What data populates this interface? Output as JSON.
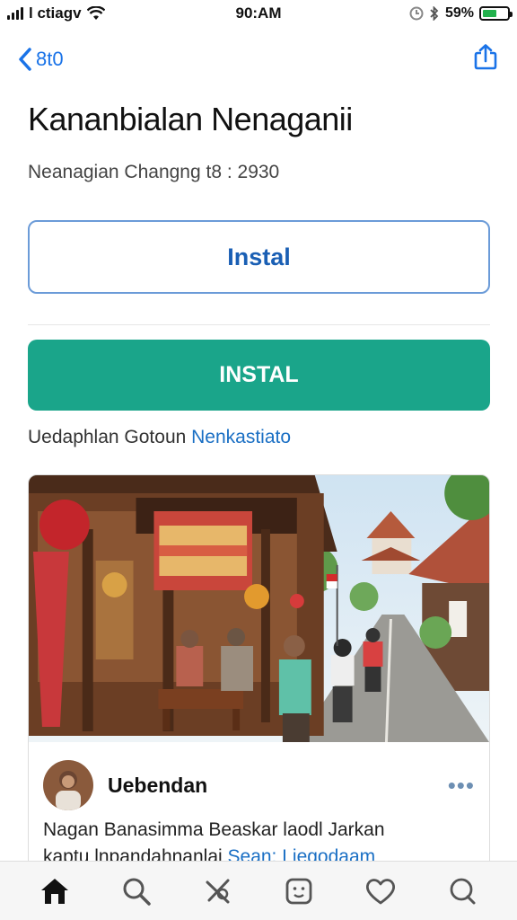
{
  "status_bar": {
    "carrier": "l ctiagv",
    "time": "90:AM",
    "battery_percent": "59%",
    "battery_level": 0.59
  },
  "nav": {
    "back_label": "8t0"
  },
  "header": {
    "title": "Kananbialan Nenaganii",
    "subtitle": "Neanagian Changng t8 : 2930"
  },
  "actions": {
    "install_outline_label": "Instal",
    "install_primary_label": "INSTAL"
  },
  "update": {
    "prefix": "Uedaphlan Gotoun ",
    "link": "Nenkastiato"
  },
  "post": {
    "author": "Uebendan",
    "more_label": "•••",
    "text_line1": "Nagan Banasimma Beaskar laodl Jarkan",
    "text_line2_prefix": "kaptu lnpandahnanlai ",
    "text_line2_tag": "Sean: Liegodaam"
  },
  "colors": {
    "accent_blue": "#1a73e8",
    "primary_green": "#1aa58a",
    "battery_green": "#22b14c"
  },
  "tabbar": {
    "icons": [
      "home-icon",
      "search-icon",
      "tools-icon",
      "face-icon",
      "heart-icon",
      "chat-icon"
    ],
    "active_index": 0
  }
}
